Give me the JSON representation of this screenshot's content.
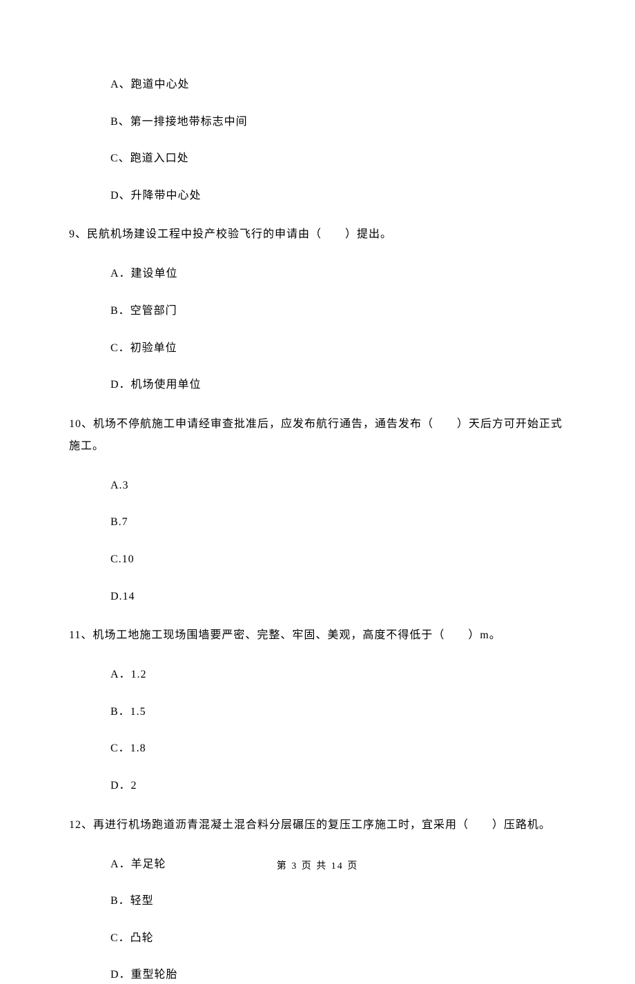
{
  "q8": {
    "options": {
      "a": "A、跑道中心处",
      "b": "B、第一排接地带标志中间",
      "c": "C、跑道入口处",
      "d": "D、升降带中心处"
    }
  },
  "q9": {
    "text": "9、民航机场建设工程中投产校验飞行的申请由（　　）提出。",
    "options": {
      "a": "A．建设单位",
      "b": "B．空管部门",
      "c": "C．初验单位",
      "d": "D．机场使用单位"
    }
  },
  "q10": {
    "text": "10、机场不停航施工申请经审查批准后，应发布航行通告，通告发布（　　）天后方可开始正式施工。",
    "options": {
      "a": "A.3",
      "b": "B.7",
      "c": "C.10",
      "d": "D.14"
    }
  },
  "q11": {
    "text": "11、机场工地施工现场围墙要严密、完整、牢固、美观，高度不得低于（　　）m。",
    "options": {
      "a": "A．1.2",
      "b": "B．1.5",
      "c": "C．1.8",
      "d": "D．2"
    }
  },
  "q12": {
    "text": "12、再进行机场跑道沥青混凝土混合料分层碾压的复压工序施工时，宜采用（　　）压路机。",
    "options": {
      "a": "A．羊足轮",
      "b": "B．轻型",
      "c": "C．凸轮",
      "d": "D．重型轮胎"
    }
  },
  "footer": "第 3 页 共 14 页"
}
